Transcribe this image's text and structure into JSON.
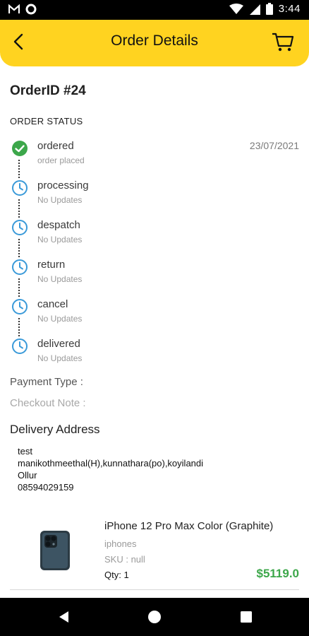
{
  "status_bar": {
    "time": "3:44"
  },
  "header": {
    "title": "Order Details"
  },
  "order": {
    "id_text": "OrderID #24",
    "status_heading": "ORDER STATUS",
    "timeline": [
      {
        "label": "ordered",
        "sub": "order placed",
        "date": "23/07/2021",
        "state": "done"
      },
      {
        "label": "processing",
        "sub": "No Updates",
        "date": "",
        "state": "pending"
      },
      {
        "label": "despatch",
        "sub": "No Updates",
        "date": "",
        "state": "pending"
      },
      {
        "label": "return",
        "sub": "No Updates",
        "date": "",
        "state": "pending"
      },
      {
        "label": "cancel",
        "sub": "No Updates",
        "date": "",
        "state": "pending"
      },
      {
        "label": "delivered",
        "sub": "No Updates",
        "date": "",
        "state": "pending"
      }
    ],
    "payment_type_label": "Payment Type :",
    "checkout_note_label": "Checkout Note :",
    "delivery_title": "Delivery Address",
    "address_lines": [
      "test",
      "manikothmeethal(H),kunnathara(po),koyilandi",
      "Ollur",
      "08594029159"
    ]
  },
  "product": {
    "name": "iPhone 12 Pro Max Color (Graphite)",
    "category": "iphones",
    "sku": "SKU : null",
    "qty": "Qty: 1",
    "price": "$5119.0"
  },
  "colors": {
    "accent": "#ffd320",
    "done": "#3ca74a",
    "pending": "#3a9ad9",
    "price": "#3ca74a"
  },
  "icons": {
    "back": "arrow-left-icon",
    "cart": "cart-icon",
    "done": "check-circle-icon",
    "pending": "clock-icon"
  }
}
